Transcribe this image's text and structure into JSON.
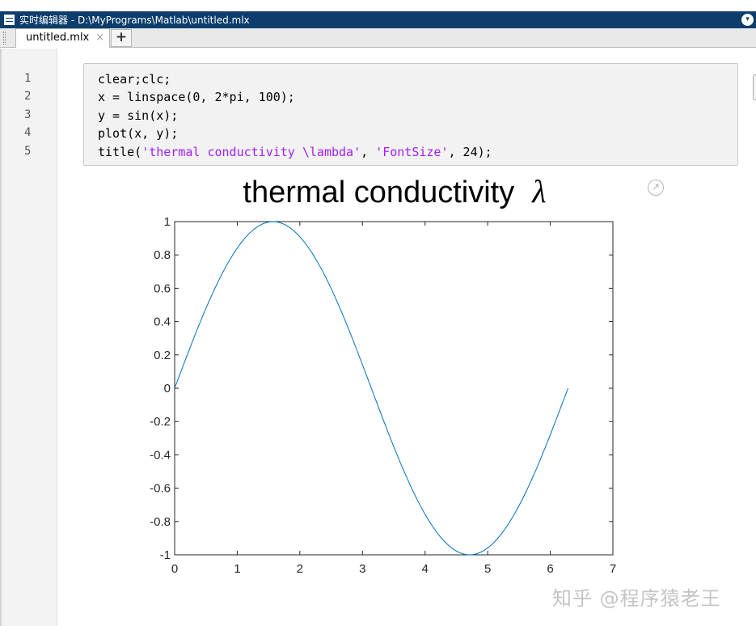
{
  "window": {
    "title": "实时编辑器 - D:\\MyPrograms\\Matlab\\untitled.mlx"
  },
  "tabs": [
    {
      "label": "untitled.mlx",
      "close": "×"
    }
  ],
  "new_tab_label": "+",
  "title_menu_glyph": "▾",
  "code": {
    "line_numbers": [
      "1",
      "2",
      "3",
      "4",
      "5"
    ],
    "lines": [
      {
        "text": "clear;clc;"
      },
      {
        "text": "x = linspace(0, 2*pi, 100);"
      },
      {
        "text": "y = sin(x);"
      },
      {
        "text": "plot(x, y);"
      },
      {
        "before": "title(",
        "str1": "'thermal conductivity \\lambda'",
        "mid": ", ",
        "str2": "'FontSize'",
        "after": ", 24);"
      }
    ]
  },
  "chart_data": {
    "type": "line",
    "title": "thermal  conductivity",
    "title_symbol": "λ",
    "xlim": [
      0,
      7
    ],
    "ylim": [
      -1,
      1
    ],
    "x_ticks": [
      "0",
      "1",
      "2",
      "3",
      "4",
      "5",
      "6",
      "7"
    ],
    "y_ticks": [
      "1",
      "0.8",
      "0.6",
      "0.4",
      "0.2",
      "0",
      "-0.2",
      "-0.4",
      "-0.6",
      "-0.8",
      "-1"
    ],
    "series": [
      {
        "function": "sin(x)",
        "x_range": [
          0,
          6.2832
        ],
        "n_points": 100,
        "color": "#0072bd"
      }
    ],
    "grid": false
  },
  "export_icon": "export-figure-icon",
  "watermark": "知乎 @程序猿老王",
  "colors": {
    "titlebar": "#0c3d6c",
    "string": "#a020f0",
    "line": "#0072bd"
  }
}
